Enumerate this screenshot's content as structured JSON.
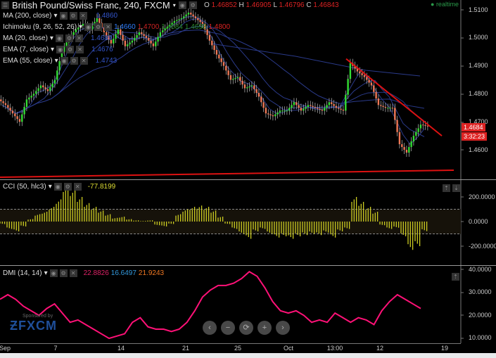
{
  "header": {
    "title": "British Pound/Swiss Franc, 240, FXCM",
    "ohlc": {
      "o_label": "O",
      "o": "1.46852",
      "h_label": "H",
      "h": "1.46905",
      "l_label": "L",
      "l": "1.46796",
      "c_label": "C",
      "c": "1.46843"
    },
    "status": "realtime"
  },
  "indicators": [
    {
      "label": "MA (200, close)",
      "value": "1.4860",
      "color": "#3355cc"
    },
    {
      "label": "Ichimoku (9, 26, 52, 26)",
      "values": [
        "1.4660",
        "1.4700",
        "1.4684",
        "1.4698",
        "1.4800"
      ],
      "colors": [
        "#2f7fff",
        "#cc2222",
        "#2a8a2a",
        "#2a8a2a",
        "#dd2222"
      ]
    },
    {
      "label": "MA (20, close)",
      "value": "1.4689",
      "color": "#3355cc"
    },
    {
      "label": "EMA (7, close)",
      "value": "1.4676",
      "color": "#3355cc"
    },
    {
      "label": "EMA (55, close)",
      "value": "1.4743",
      "color": "#3355cc"
    }
  ],
  "cci": {
    "label": "CCI (50, hlc3)",
    "value": "-77.8199",
    "color": "#cccc22"
  },
  "dmi": {
    "label": "DMI (14, 14)",
    "values": [
      "22.8826",
      "16.6497",
      "21.9243"
    ],
    "colors": [
      "#dd2266",
      "#3399dd",
      "#ee7722"
    ]
  },
  "price_tag": {
    "price": "1.4684",
    "countdown": "3:32:23"
  },
  "sponsor": {
    "text": "Sponsored by",
    "brand": "FXCM"
  },
  "nav": {
    "icons": [
      "chevron-left",
      "zoom-out",
      "reset",
      "zoom-in",
      "chevron-right"
    ],
    "glyphs": [
      "‹",
      "−",
      "⟳",
      "+",
      "›"
    ]
  },
  "colors": {
    "up": "#33dd33",
    "down": "#ee7755",
    "trendline": "#dd1111",
    "ma": "#2a3a8a",
    "dmi_line": "#ff1177",
    "cci_bar": "#cccc22"
  },
  "chart_data": [
    {
      "type": "candlestick",
      "title": "British Pound/Swiss Franc, 240, FXCM",
      "x_ticks": [
        "Sep",
        "7",
        "14",
        "21",
        "25",
        "Oct",
        "13:00",
        "12",
        "19"
      ],
      "y_ticks": [
        "1.5100",
        "1.5000",
        "1.4900",
        "1.4800",
        "1.4700",
        "1.4600"
      ],
      "ylim": [
        1.4567,
        1.5135
      ],
      "closes": [
        1.476,
        1.473,
        1.47,
        1.478,
        1.48,
        1.483,
        1.481,
        1.485,
        1.495,
        1.5,
        1.503,
        1.505,
        1.503,
        1.507,
        1.502,
        1.498,
        1.503,
        1.497,
        1.499,
        1.502,
        1.5,
        1.497,
        1.502,
        1.504,
        1.506,
        1.507,
        1.509,
        1.507,
        1.505,
        1.499,
        1.494,
        1.49,
        1.485,
        1.486,
        1.482,
        1.483,
        1.479,
        1.473,
        1.472,
        1.474,
        1.474,
        1.477,
        1.474,
        1.476,
        1.475,
        1.474,
        1.477,
        1.475,
        1.474,
        1.491,
        1.488,
        1.486,
        1.483,
        1.476,
        1.475,
        1.475,
        1.462,
        1.459,
        1.465,
        1.469,
        1.4684
      ],
      "trendlines": [
        {
          "from": [
            1.4925
          ],
          "to": [
            1.469
          ]
        },
        {
          "from": [
            1.456
          ],
          "to": [
            1.4578
          ]
        }
      ]
    },
    {
      "type": "bar",
      "title": "CCI (50, hlc3)",
      "y_ticks": [
        "200.0000",
        "0.0000",
        "-200.0000"
      ],
      "ylim": [
        -310,
        310
      ],
      "bands": [
        100,
        -100
      ],
      "values": [
        -20,
        -60,
        -80,
        -40,
        20,
        60,
        80,
        120,
        180,
        300,
        260,
        200,
        150,
        120,
        90,
        60,
        30,
        40,
        20,
        10,
        5,
        10,
        -30,
        -40,
        -20,
        60,
        100,
        120,
        130,
        120,
        90,
        40,
        -20,
        -60,
        -100,
        -140,
        -80,
        -60,
        -100,
        -130,
        -120,
        -140,
        -120,
        -110,
        -100,
        -110,
        -90,
        -130,
        -80,
        -60,
        200,
        160,
        120,
        80,
        -30,
        -60,
        -50,
        -120,
        -230,
        -200,
        -78
      ]
    },
    {
      "type": "line",
      "title": "DMI (14, 14)",
      "y_ticks": [
        "40.0000",
        "30.0000",
        "20.0000",
        "10.0000"
      ],
      "ylim": [
        8.5,
        41.5
      ],
      "values": [
        27,
        29,
        27,
        24,
        22,
        20,
        23,
        25,
        21,
        17,
        18,
        16,
        14,
        12,
        10,
        11,
        12,
        17,
        19,
        15,
        14,
        14,
        13,
        14,
        17,
        22,
        28,
        31,
        33,
        33,
        34,
        36,
        39,
        37,
        32,
        26,
        22,
        21,
        22,
        20,
        17,
        18,
        17,
        21,
        19,
        17,
        19,
        18,
        16,
        22,
        26,
        29,
        27,
        25,
        23
      ]
    }
  ]
}
